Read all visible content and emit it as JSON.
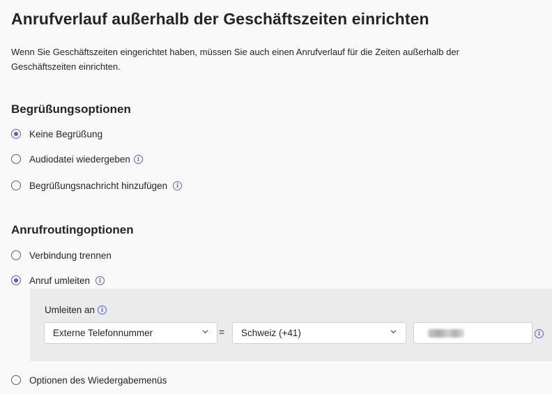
{
  "page": {
    "title": "Anrufverlauf außerhalb der Geschäftszeiten einrichten",
    "description": "Wenn Sie Geschäftszeiten eingerichtet haben, müssen Sie auch einen Anrufverlauf für die Zeiten außerhalb der Geschäftszeiten einrichten."
  },
  "greeting": {
    "heading": "Begrüßungsoptionen",
    "options": [
      {
        "label": "Keine Begrüßung",
        "selected": true
      },
      {
        "label": "Audiodatei wiedergeben",
        "selected": false
      },
      {
        "label": "Begrüßungsnachricht hinzufügen",
        "selected": false
      }
    ]
  },
  "routing": {
    "heading": "Anrufroutingoptionen",
    "options": [
      {
        "label": "Verbindung trennen",
        "selected": false
      },
      {
        "label": "Anruf umleiten",
        "selected": true
      },
      {
        "label": "Optionen des Wiedergabemenüs",
        "selected": false
      }
    ],
    "redirect": {
      "label": "Umleiten an",
      "target_type": "Externe Telefonnummer",
      "equals": "=",
      "country": "Schweiz (+41)",
      "phone_value_redacted": true
    }
  },
  "icons": {
    "info": "info-icon",
    "chevron": "chevron-down-icon"
  },
  "colors": {
    "accent": "#5b5fc7",
    "panel": "#ebebeb",
    "background": "#f9f9f9"
  }
}
